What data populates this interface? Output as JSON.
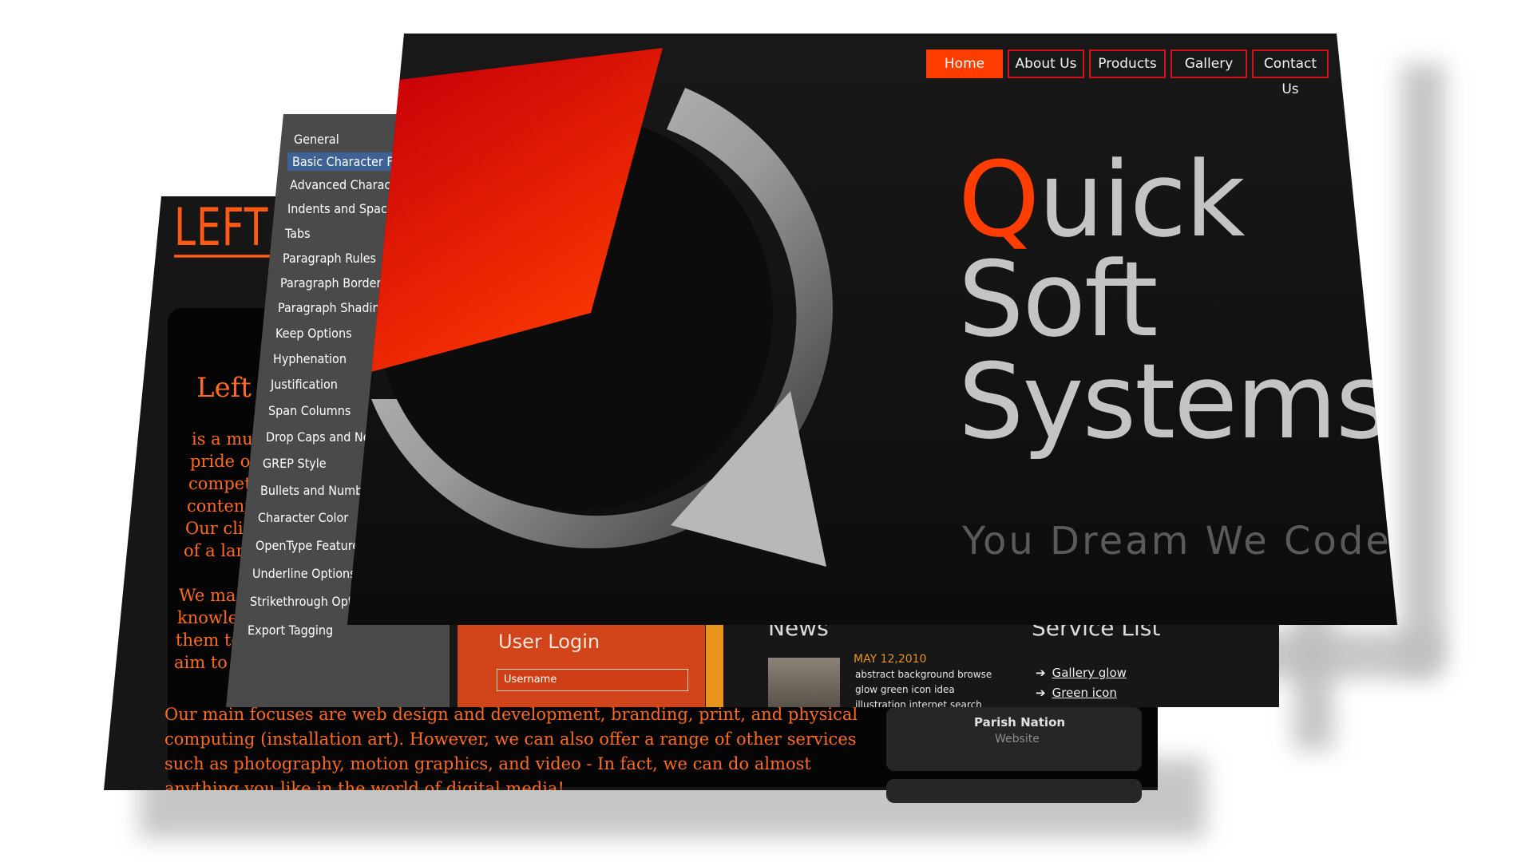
{
  "back_page": {
    "title": "LEFT C",
    "subtitle": "Left C",
    "lines": [
      "is a mul",
      "pride o",
      "compet",
      "content",
      "Our cli",
      "of a lar",
      "We ma",
      "knowle",
      "them to",
      "aim to"
    ],
    "paragraph": "Our main focuses are web design and development, branding, print, and physical computing (installation art). However, we can also offer a range of other services such as photography, motion graphics, and video - In fact, we can do almost anything you like in the world of digital media!"
  },
  "middle_page": {
    "menu_items": [
      "General",
      "Basic Character For",
      "Advanced Characte",
      "Indents and Spacin",
      "Tabs",
      "Paragraph Rules",
      "Paragraph Border",
      "Paragraph Shading",
      "Keep Options",
      "Hyphenation",
      "Justification",
      "Span Columns",
      "Drop Caps and Ne",
      "GREP Style",
      "Bullets and Numbe",
      "Character Color",
      "OpenType Feature",
      "Underline Options",
      "Strikethrough Opt",
      "Export Tagging"
    ],
    "login": {
      "title": "User  Login",
      "username_placeholder": "Username"
    },
    "news": {
      "title": "News",
      "date": "MAY 12,2010",
      "lines": [
        "abstract background browse",
        "glow green icon idea",
        "illustration internet search"
      ]
    },
    "services": {
      "title": "Service List",
      "items": [
        "Gallery glow",
        "Green icon"
      ]
    },
    "project": {
      "name": "Parish Nation",
      "type": "Website"
    }
  },
  "front_page": {
    "nav": [
      "Home",
      "About Us",
      "Products",
      "Gallery",
      "Contact Us"
    ],
    "brand": {
      "line1_accent": "Q",
      "line1_rest": "uick",
      "line2": "Soft",
      "line3": "Systems"
    },
    "tagline": "You Dream We Code"
  },
  "colors": {
    "accent": "#ff3d00",
    "nav_border": "#d2101a",
    "brand_text": "#c4c4c4",
    "menu_selected": "#3f6296"
  }
}
